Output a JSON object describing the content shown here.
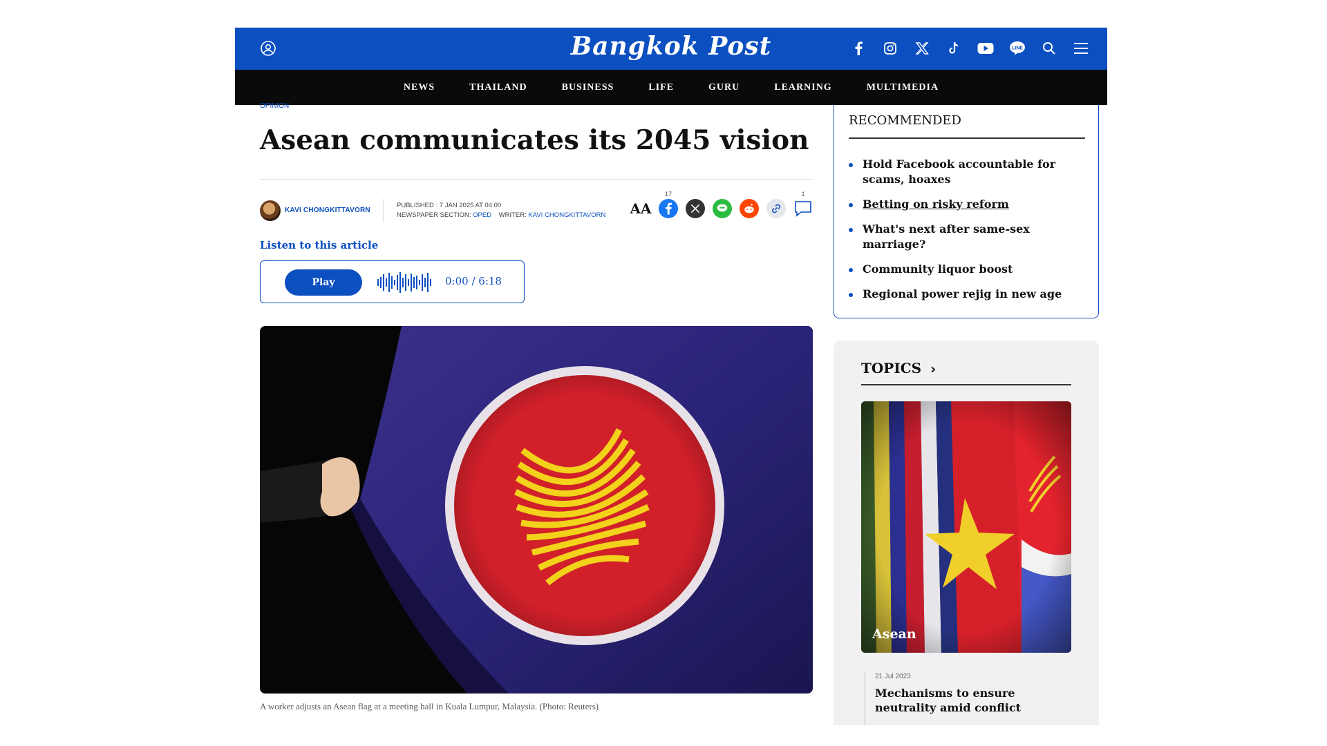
{
  "header": {
    "logo": "Bangkok Post",
    "social_icons": [
      "facebook-icon",
      "instagram-icon",
      "x-icon",
      "tiktok-icon",
      "youtube-icon",
      "line-icon",
      "search-icon",
      "menu-icon"
    ]
  },
  "nav": {
    "items": [
      "NEWS",
      "THAILAND",
      "BUSINESS",
      "LIFE",
      "GURU",
      "LEARNING",
      "MULTIMEDIA"
    ]
  },
  "article": {
    "section": "OPINION",
    "headline": "Asean communicates its 2045 vision",
    "author": "KAVI CHONGKITTAVORN",
    "published_label": "PUBLISHED : 7 JAN 2025 AT 04:00",
    "section_label": "NEWSPAPER SECTION:",
    "section_value": "OPED",
    "writer_label": "WRITER:",
    "writer_value": "KAVI CHONGKITTAVORN",
    "font_size_label": "AA",
    "facebook_count": "17",
    "comment_count": "1",
    "listen_label": "Listen to this article",
    "play_label": "Play",
    "time": "0:00 / 6:18",
    "caption": "A worker adjusts an Asean flag at a meeting hall in Kuala Lumpur, Malaysia. (Photo: Reuters)"
  },
  "sidebar": {
    "recommended_title": "RECOMMENDED",
    "recommended": [
      "Hold Facebook accountable for scams, hoaxes",
      "Betting on risky reform",
      "What's next after same-sex marriage?",
      "Community liquor boost",
      "Regional power rejig in new age"
    ],
    "topics_title": "TOPICS",
    "topic_label": "Asean",
    "topic_date": "21 Jul 2023",
    "topic_story": "Mechanisms to ensure neutrality amid conflict"
  },
  "colors": {
    "brand_blue": "#0b4fc0",
    "nav_black": "#0a0a0a"
  }
}
